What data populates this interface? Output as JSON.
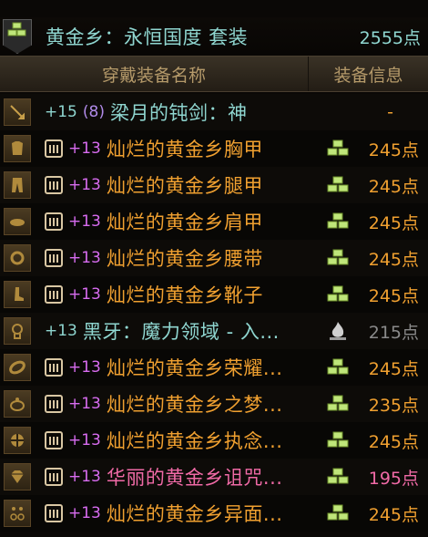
{
  "colors": {
    "title": "#8fd6d0",
    "header_text": "#b59a6a",
    "plus_magenta": "#d86cf0",
    "plus_cyan": "#8fd6d0",
    "legendary_orange": "#f0a030",
    "rare_pink": "#f06aa6",
    "epic_purple": "#d38cf5",
    "points_orange": "#f0a030",
    "points_grey": "#8a8a8a",
    "points_pink": "#f06aa6"
  },
  "title": {
    "text": "黄金乡：永恒国度  套装",
    "points": "2555点",
    "icon": "gold-set-icon"
  },
  "header": {
    "name_col": "穿戴装备名称",
    "info_col": "装备信息"
  },
  "rows": [
    {
      "slot_icon": "weapon-icon",
      "badge": false,
      "plus": "+15",
      "prefix": "(8)",
      "name": "梁月的钝剑：神",
      "name_color": "#8fd6d0",
      "grade_icon": "",
      "points": "-",
      "points_color": "#f0a030"
    },
    {
      "slot_icon": "chest-armor-icon",
      "badge": true,
      "plus": "+13",
      "name": "灿烂的黄金乡胸甲",
      "name_color": "#f0a030",
      "grade_icon": "gold-set-icon",
      "points": "245点",
      "points_color": "#f0a030"
    },
    {
      "slot_icon": "leg-armor-icon",
      "badge": true,
      "plus": "+13",
      "name": "灿烂的黄金乡腿甲",
      "name_color": "#f0a030",
      "grade_icon": "gold-set-icon",
      "points": "245点",
      "points_color": "#f0a030"
    },
    {
      "slot_icon": "shoulder-armor-icon",
      "badge": true,
      "plus": "+13",
      "name": "灿烂的黄金乡肩甲",
      "name_color": "#f0a030",
      "grade_icon": "gold-set-icon",
      "points": "245点",
      "points_color": "#f0a030"
    },
    {
      "slot_icon": "belt-icon",
      "badge": true,
      "plus": "+13",
      "name": "灿烂的黄金乡腰带",
      "name_color": "#f0a030",
      "grade_icon": "gold-set-icon",
      "points": "245点",
      "points_color": "#f0a030"
    },
    {
      "slot_icon": "boots-icon",
      "badge": true,
      "plus": "+13",
      "name": "灿烂的黄金乡靴子",
      "name_color": "#f0a030",
      "grade_icon": "gold-set-icon",
      "points": "245点",
      "points_color": "#f0a030"
    },
    {
      "slot_icon": "title-icon",
      "badge": false,
      "plus": "+13",
      "name": "黑牙：魔力领域 - 入...",
      "name_color": "#8fd6d0",
      "grade_icon": "flame-grade-icon",
      "points": "215点",
      "points_color": "#8a8a8a"
    },
    {
      "slot_icon": "bracelet-icon",
      "badge": true,
      "plus": "+13",
      "name": "灿烂的黄金乡荣耀...",
      "name_color": "#f0a030",
      "grade_icon": "gold-set-icon",
      "points": "245点",
      "points_color": "#f0a030"
    },
    {
      "slot_icon": "ring-icon",
      "badge": true,
      "plus": "+13",
      "name": "灿烂的黄金乡之梦...",
      "name_color": "#f0a030",
      "grade_icon": "gold-set-icon",
      "points": "235点",
      "points_color": "#f0a030"
    },
    {
      "slot_icon": "necklace-icon",
      "badge": true,
      "plus": "+13",
      "name": "灿烂的黄金乡执念...",
      "name_color": "#f0a030",
      "grade_icon": "gold-set-icon",
      "points": "245点",
      "points_color": "#f0a030"
    },
    {
      "slot_icon": "gem-icon",
      "badge": true,
      "plus": "+13",
      "name": "华丽的黄金乡诅咒...",
      "name_color": "#f06aa6",
      "grade_icon": "pink-gem-icon",
      "points": "195点",
      "points_color": "#f06aa6"
    },
    {
      "slot_icon": "earring-icon",
      "badge": true,
      "plus": "+13",
      "name": "灿烂的黄金乡异面...",
      "name_color": "#f0a030",
      "grade_icon": "gold-set-icon",
      "points": "245点",
      "points_color": "#f0a030"
    }
  ]
}
